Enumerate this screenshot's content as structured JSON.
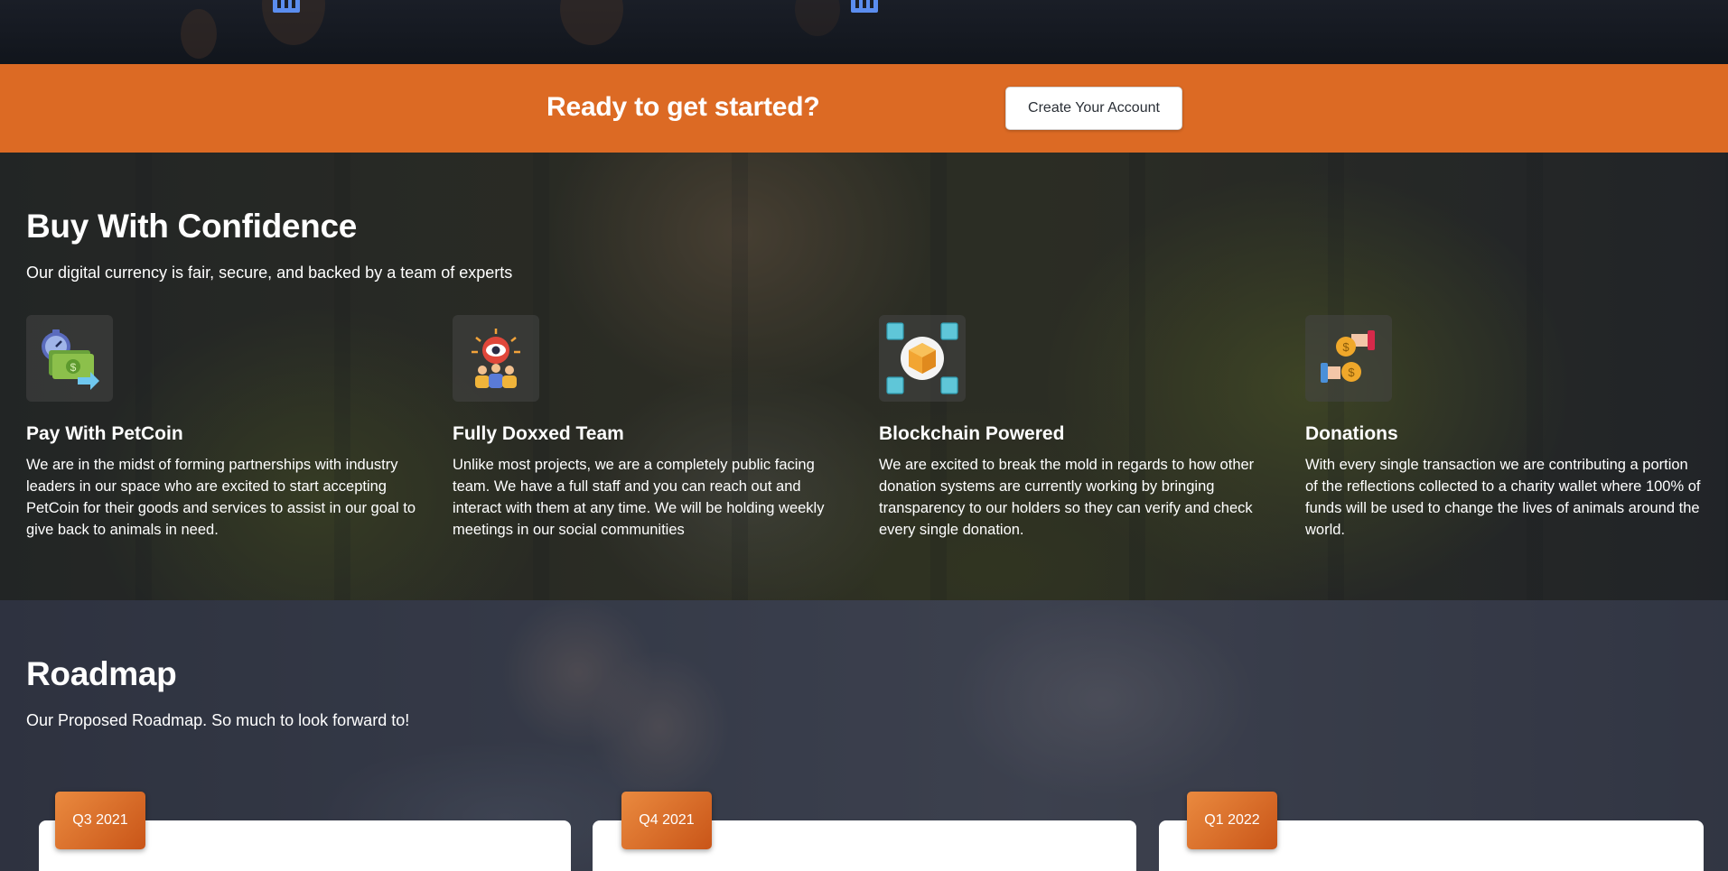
{
  "cta": {
    "title": "Ready to get started?",
    "button_label": "Create Your Account"
  },
  "confidence": {
    "title": "Buy With Confidence",
    "subtitle": "Our digital currency is fair, secure, and backed by a team of experts",
    "features": [
      {
        "icon": "payment-icon",
        "title": "Pay With PetCoin",
        "text": "We are in the midst of forming partnerships with industry leaders in our space who are excited to start accepting PetCoin for their goods and services to assist in our goal to give back to animals in need."
      },
      {
        "icon": "team-icon",
        "title": "Fully Doxxed Team",
        "text": "Unlike most projects, we are a completely public facing team. We have a full staff and you can reach out and interact with them at any time. We will be holding weekly meetings in our social communities"
      },
      {
        "icon": "blockchain-icon",
        "title": "Blockchain Powered",
        "text": "We are excited to break the mold in regards to how other donation systems are currently working by bringing transparency to our holders so they can verify and check every single donation."
      },
      {
        "icon": "donation-icon",
        "title": "Donations",
        "text": "With every single transaction we are contributing a portion of the reflections collected to a charity wallet where 100% of funds will be used to change the lives of animals around the world."
      }
    ]
  },
  "roadmap": {
    "title": "Roadmap",
    "subtitle": "Our Proposed Roadmap. So much to look forward to!",
    "phases": [
      {
        "label": "Q3 2021"
      },
      {
        "label": "Q4 2021"
      },
      {
        "label": "Q1 2022"
      }
    ]
  },
  "colors": {
    "accent": "#dc6a24",
    "badge": "#e07a30",
    "stat_icon": "#5b8def"
  }
}
